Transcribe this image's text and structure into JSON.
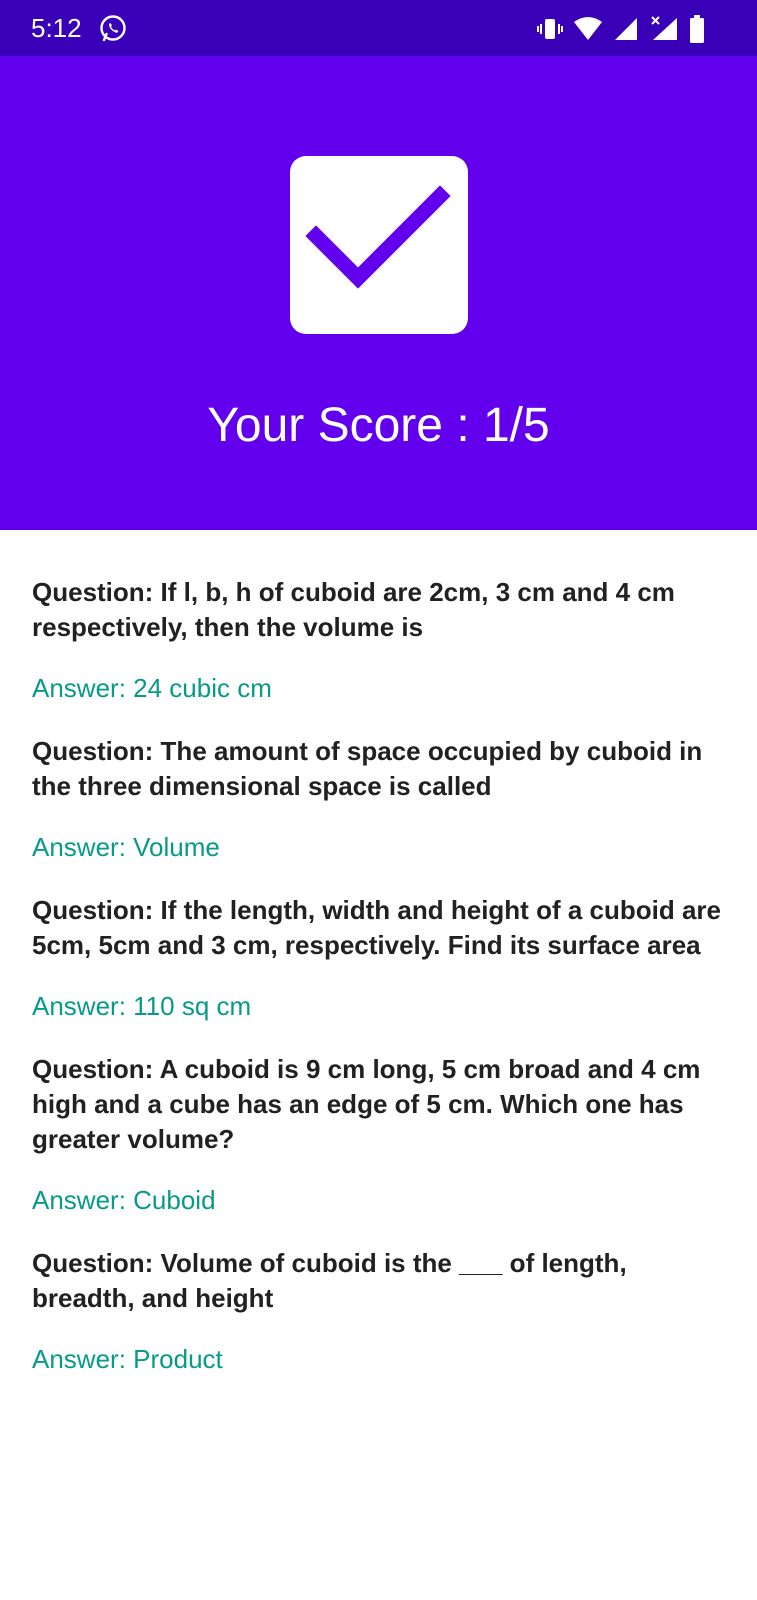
{
  "status_bar": {
    "time": "5:12",
    "icons": [
      "whatsapp-icon",
      "vibrate-icon",
      "wifi-icon",
      "signal-icon",
      "signal-no-data-icon",
      "battery-icon"
    ],
    "background": "#3a00b8"
  },
  "header": {
    "background": "#6200ee",
    "icon": "checkbox-checked-icon",
    "score_text": "Your Score : 1/5"
  },
  "results": [
    {
      "question": "Question: If l, b, h of cuboid are 2cm, 3 cm and 4 cm respectively, then the volume is",
      "answer": "Answer: 24 cubic cm"
    },
    {
      "question": "Question: The amount of space occupied by cuboid in the three dimensional space is called",
      "answer": "Answer: Volume"
    },
    {
      "question": "Question: If the length, width and height of a cuboid are 5cm, 5cm and 3 cm, respectively. Find its surface area",
      "answer": "Answer: 110 sq cm"
    },
    {
      "question": "Question: A cuboid is 9 cm long, 5 cm broad and 4 cm high and a cube has an edge of 5 cm. Which one has greater volume?",
      "answer": "Answer: Cuboid"
    },
    {
      "question": "Question: Volume of cuboid is the ___ of length, breadth, and height",
      "answer": "Answer: Product"
    }
  ],
  "colors": {
    "question_text": "#212121",
    "answer_text": "#079a8a"
  }
}
